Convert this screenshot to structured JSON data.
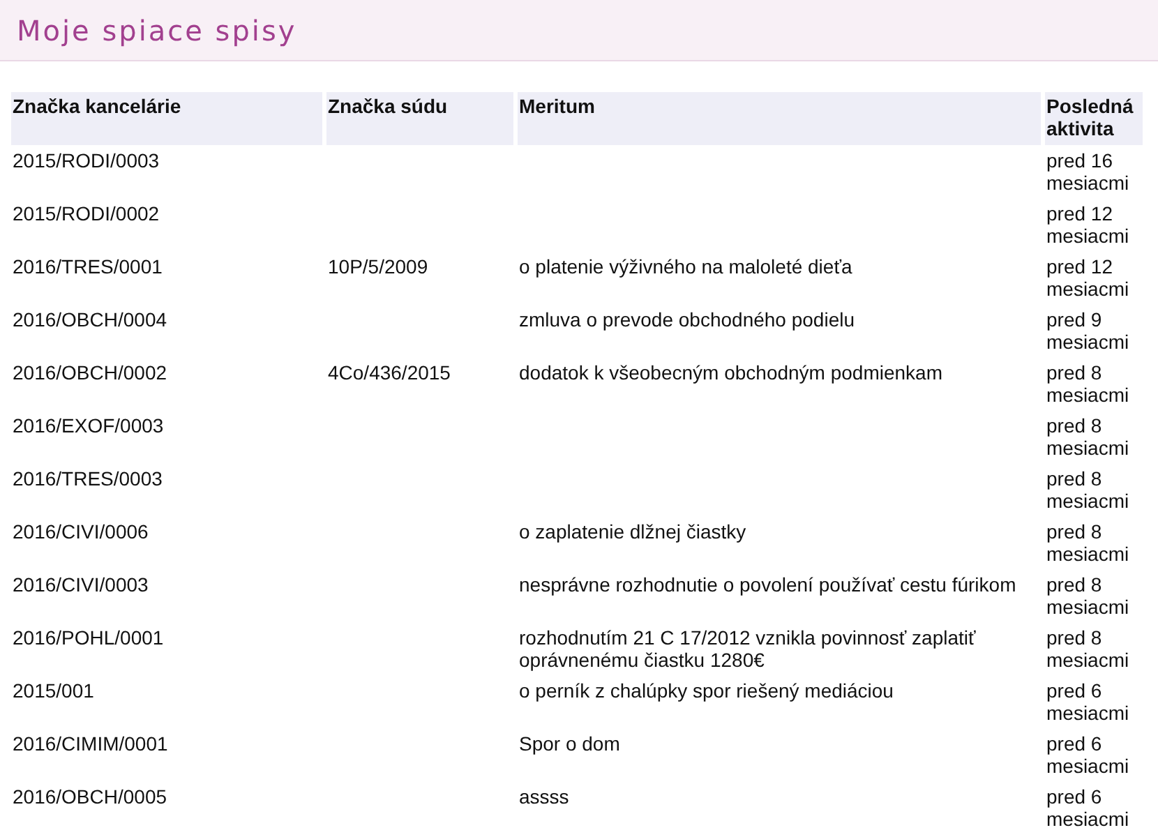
{
  "header": {
    "title": "Moje spiace spisy"
  },
  "table": {
    "columns": [
      "Značka kancelárie",
      "Značka súdu",
      "Meritum",
      "Posledná aktivita"
    ],
    "rows": [
      {
        "office_ref": "2015/RODI/0003",
        "court_ref": "",
        "subject": "",
        "last_activity": "pred 16 mesiacmi"
      },
      {
        "office_ref": "2015/RODI/0002",
        "court_ref": "",
        "subject": "",
        "last_activity": "pred 12 mesiacmi"
      },
      {
        "office_ref": "2016/TRES/0001",
        "court_ref": "10P/5/2009",
        "subject": "o platenie výživného na maloleté dieťa",
        "last_activity": "pred 12 mesiacmi"
      },
      {
        "office_ref": "2016/OBCH/0004",
        "court_ref": "",
        "subject": "zmluva o prevode obchodného podielu",
        "last_activity": "pred 9 mesiacmi"
      },
      {
        "office_ref": "2016/OBCH/0002",
        "court_ref": "4Co/436/2015",
        "subject": "dodatok k všeobecným obchodným podmienkam",
        "last_activity": "pred 8 mesiacmi"
      },
      {
        "office_ref": "2016/EXOF/0003",
        "court_ref": "",
        "subject": "",
        "last_activity": "pred 8 mesiacmi"
      },
      {
        "office_ref": "2016/TRES/0003",
        "court_ref": "",
        "subject": "",
        "last_activity": "pred 8 mesiacmi"
      },
      {
        "office_ref": "2016/CIVI/0006",
        "court_ref": "",
        "subject": "o zaplatenie dlžnej čiastky",
        "last_activity": "pred 8 mesiacmi"
      },
      {
        "office_ref": "2016/CIVI/0003",
        "court_ref": "",
        "subject": "nesprávne rozhodnutie o povolení používať cestu fúrikom",
        "last_activity": "pred 8 mesiacmi"
      },
      {
        "office_ref": "2016/POHL/0001",
        "court_ref": "",
        "subject": "rozhodnutím 21 C 17/2012 vznikla povinnosť zaplatiť oprávnenému čiastku 1280€",
        "last_activity": "pred 8 mesiacmi"
      },
      {
        "office_ref": "2015/001",
        "court_ref": "",
        "subject": "o perník z chalúpky spor riešený mediáciou",
        "last_activity": "pred 6 mesiacmi"
      },
      {
        "office_ref": "2016/CIMIM/0001",
        "court_ref": "",
        "subject": "Spor o dom",
        "last_activity": "pred 6 mesiacmi"
      },
      {
        "office_ref": "2016/OBCH/0005",
        "court_ref": "",
        "subject": "assss",
        "last_activity": "pred 6 mesiacmi"
      }
    ]
  }
}
